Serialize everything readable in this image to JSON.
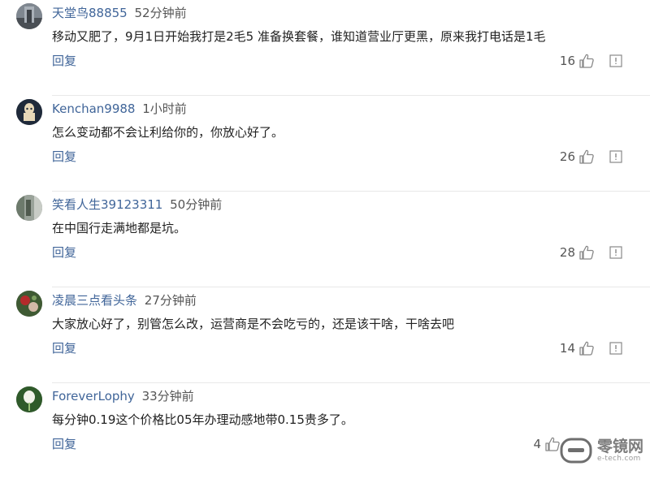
{
  "comments": [
    {
      "username": "天堂鸟88855",
      "time": "52分钟前",
      "content": "移动又肥了，9月1日开始我打是2毛5 准备换套餐，谁知道营业厅更黑，原来我打电话是1毛",
      "reply": "回复",
      "likes": "16"
    },
    {
      "username": "Kenchan9988",
      "time": "1小时前",
      "content": "怎么变动都不会让利给你的，你放心好了。",
      "reply": "回复",
      "likes": "26"
    },
    {
      "username": "笑看人生39123311",
      "time": "50分钟前",
      "content": "在中国行走满地都是坑。",
      "reply": "回复",
      "likes": "28"
    },
    {
      "username": "凌晨三点看头条",
      "time": "27分钟前",
      "content": "大家放心好了，别管怎么改，运营商是不会吃亏的，还是该干啥，干啥去吧",
      "reply": "回复",
      "likes": "14"
    },
    {
      "username": "ForeverLophy",
      "time": "33分钟前",
      "content": "每分钟0.19这个价格比05年办理动感地带0.15贵多了。",
      "reply": "回复",
      "likes": "4"
    }
  ],
  "watermark": {
    "brand": "零镜网",
    "site": "e-tech.com"
  }
}
